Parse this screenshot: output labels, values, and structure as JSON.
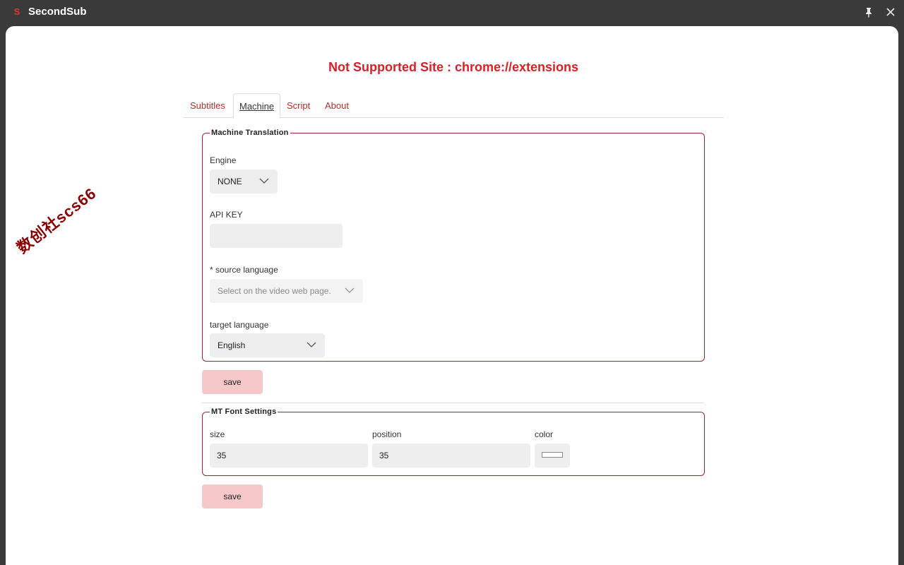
{
  "app": {
    "logo_glyph": "S",
    "title": "SecondSub"
  },
  "warning": "Not Supported Site : chrome://extensions",
  "tabs": [
    {
      "label": "Subtitles"
    },
    {
      "label": "Machine"
    },
    {
      "label": "Script"
    },
    {
      "label": "About"
    }
  ],
  "machine_translation": {
    "legend": "Machine Translation",
    "engine_label": "Engine",
    "engine_value": "NONE",
    "api_key_label": "API KEY",
    "api_key_value": "",
    "source_label": "* source language",
    "source_placeholder": "Select on the video web page.",
    "target_label": "target language",
    "target_value": "English",
    "save_label": "save"
  },
  "font_settings": {
    "legend": "MT Font Settings",
    "size_label": "size",
    "size_value": "35",
    "position_label": "position",
    "position_value": "35",
    "color_label": "color",
    "color_value": "#ffffff",
    "save_label": "save"
  },
  "watermark": "数创社scs66",
  "colors": {
    "accent": "#dc1f26",
    "button_bg": "#f5c9c9",
    "fieldset_border": "#a32030"
  }
}
